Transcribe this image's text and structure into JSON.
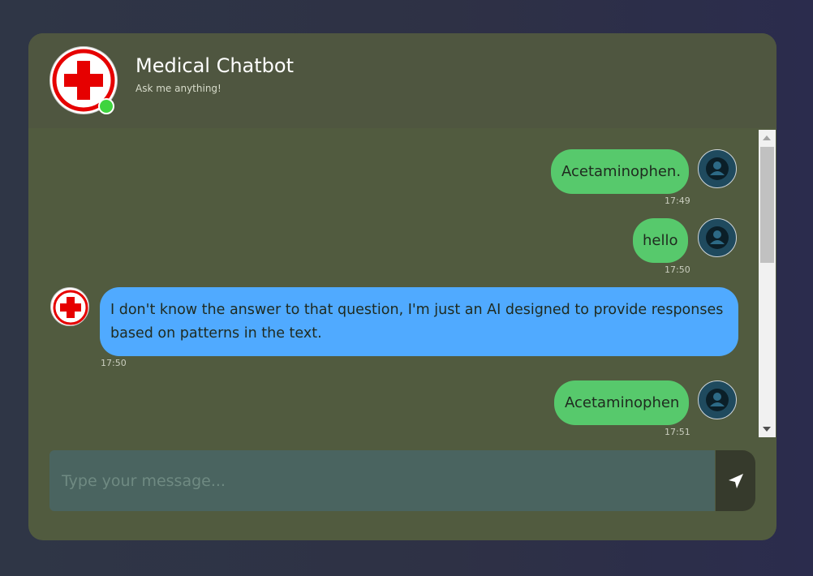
{
  "header": {
    "title": "Medical Chatbot",
    "subtitle": "Ask me anything!",
    "logo_icon": "medical-cross-icon",
    "status": "online"
  },
  "messages": [
    {
      "sender": "user",
      "text": "Acetaminophen.",
      "time": "17:49"
    },
    {
      "sender": "user",
      "text": "hello",
      "time": "17:50"
    },
    {
      "sender": "bot",
      "text": "I don't know the answer to that question, I'm just an AI designed to provide responses based on patterns in the text.",
      "time": "17:50"
    },
    {
      "sender": "user",
      "text": "Acetaminophen",
      "time": "17:51"
    }
  ],
  "composer": {
    "placeholder": "Type your message...",
    "send_icon": "send-arrow-icon"
  },
  "colors": {
    "user_bubble": "#57c96c",
    "bot_bubble": "#50aaff",
    "card": "#515b3f",
    "online": "#3fd43f"
  }
}
